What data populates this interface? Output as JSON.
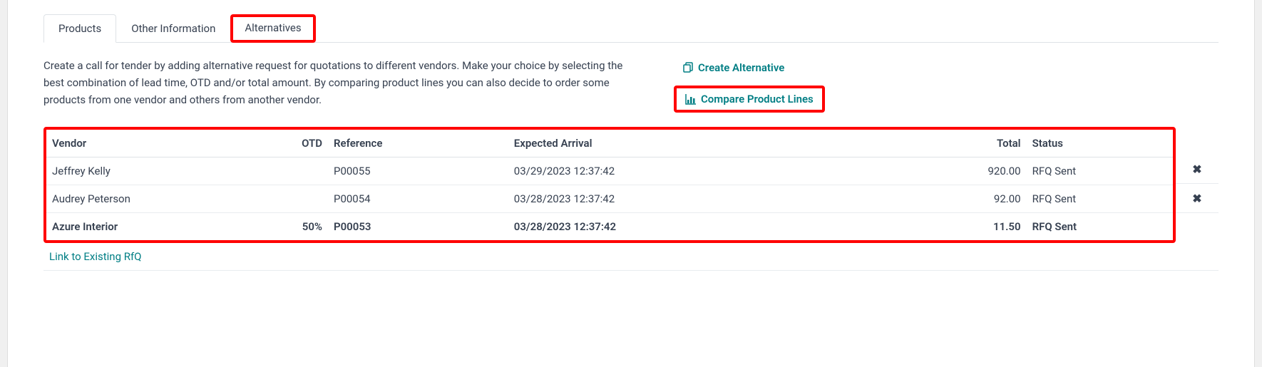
{
  "tabs": [
    {
      "label": "Products",
      "active": false,
      "highlighted": false
    },
    {
      "label": "Other Information",
      "active": false,
      "highlighted": false
    },
    {
      "label": "Alternatives",
      "active": true,
      "highlighted": true
    }
  ],
  "description": "Create a call for tender by adding alternative request for quotations to different vendors. Make your choice by selecting the best combination of lead time, OTD and/or total amount. By comparing product lines you can also decide to order some products from one vendor and others from another vendor.",
  "actions": {
    "create_alternative": "Create Alternative",
    "compare_product_lines": "Compare Product Lines"
  },
  "table": {
    "headers": {
      "vendor": "Vendor",
      "otd": "OTD",
      "reference": "Reference",
      "expected_arrival": "Expected Arrival",
      "total": "Total",
      "status": "Status"
    },
    "rows": [
      {
        "vendor": "Jeffrey Kelly",
        "otd": "",
        "reference": "P00055",
        "expected_arrival": "03/29/2023 12:37:42",
        "total": "920.00",
        "status": "RFQ Sent",
        "deletable": true,
        "current": false
      },
      {
        "vendor": "Audrey Peterson",
        "otd": "",
        "reference": "P00054",
        "expected_arrival": "03/28/2023 12:37:42",
        "total": "92.00",
        "status": "RFQ Sent",
        "deletable": true,
        "current": false
      },
      {
        "vendor": "Azure Interior",
        "otd": "50%",
        "reference": "P00053",
        "expected_arrival": "03/28/2023 12:37:42",
        "total": "11.50",
        "status": "RFQ Sent",
        "deletable": false,
        "current": true
      }
    ]
  },
  "link_existing": "Link to Existing RfQ"
}
